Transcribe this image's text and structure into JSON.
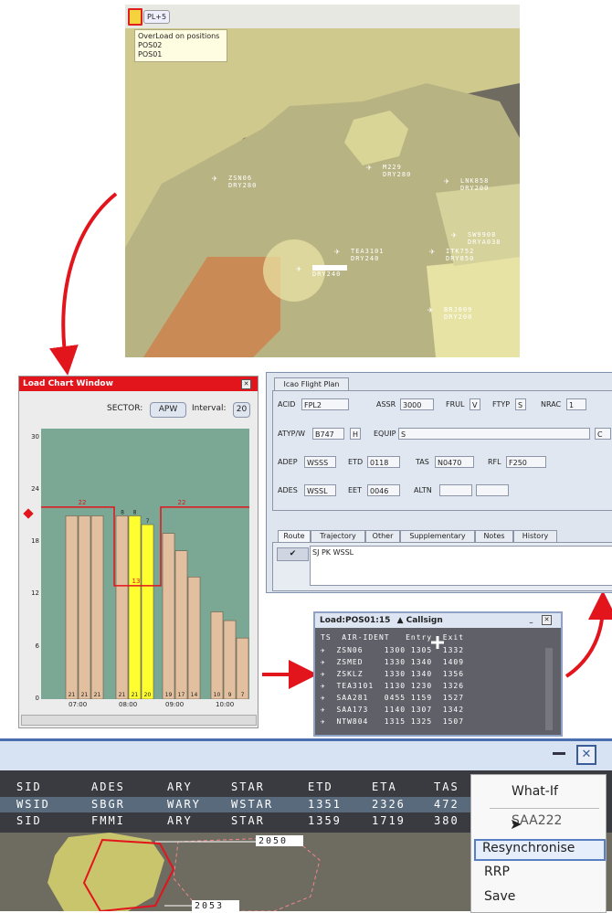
{
  "radar": {
    "toolbar": {
      "pl_button": "PL+5"
    },
    "tooltip": {
      "title": "OverLoad on positions",
      "items": [
        "POS02",
        "POS01"
      ]
    },
    "aircraft": [
      {
        "callsign": "ZSN06",
        "level": "DRY280"
      },
      {
        "callsign": "M229",
        "level": "DRY280"
      },
      {
        "callsign": "LNK858",
        "level": "DRY200"
      },
      {
        "callsign": "SW9908",
        "level": "DRYA038"
      },
      {
        "callsign": "TEA3101",
        "level": "DRY240"
      },
      {
        "callsign": "ITK752",
        "level": "DRY850"
      },
      {
        "callsign": "",
        "level": "DRY240"
      },
      {
        "callsign": "BRJ009",
        "level": "DRY200"
      }
    ]
  },
  "load_chart": {
    "title": "Load Chart Window",
    "sector_label": "SECTOR:",
    "sector_value": "APW",
    "interval_label": "Interval:",
    "interval_value": "20",
    "close_icon": "close-icon",
    "colors": {
      "title": "#e2141c",
      "plot_bg": "#7aa894",
      "bar": "#e2bf9e",
      "bar_overload": "#ffff30",
      "capacity": "#e2141c"
    }
  },
  "chart_data": {
    "type": "bar",
    "y_ticks": [
      "30",
      "24",
      "18",
      "12",
      "6",
      "0"
    ],
    "ylim": [
      0,
      31
    ],
    "x_ticks": [
      "07:00",
      "08:00",
      "09:00",
      "10:00"
    ],
    "bars": [
      {
        "value": 21,
        "label": "21",
        "overload": false
      },
      {
        "value": 21,
        "label": "21",
        "overload": false
      },
      {
        "value": 21,
        "label": "21",
        "overload": false
      },
      {
        "value": 21,
        "label": "21",
        "overload": false
      },
      {
        "value": 21,
        "label": "21",
        "overload": true,
        "top_label": "8"
      },
      {
        "value": 20,
        "label": "20",
        "overload": true,
        "top_label": "7"
      },
      {
        "value": 19,
        "label": "19",
        "overload": false
      },
      {
        "value": 17,
        "label": "17",
        "overload": false
      },
      {
        "value": 14,
        "label": "14",
        "overload": false
      },
      {
        "value": 10,
        "label": "10",
        "overload": false
      },
      {
        "value": 9,
        "label": "9",
        "overload": false
      },
      {
        "value": 7,
        "label": "7",
        "overload": false
      }
    ],
    "capacity_labels": [
      "22",
      "22",
      "13"
    ],
    "extra_labels": [
      "8"
    ]
  },
  "icao": {
    "tab": "Icao Flight Plan",
    "fields": {
      "acid_label": "ACID",
      "acid": "FPL2",
      "assr_label": "ASSR",
      "assr": "3000",
      "frul_label": "FRUL",
      "frul": "V",
      "ftyp_label": "FTYP",
      "ftyp": "S",
      "nrac_label": "NRAC",
      "nrac": "1",
      "atyp_label": "ATYP/W",
      "atyp": "B747",
      "wake": "H",
      "equip_label": "EQUIP",
      "equip": "S",
      "equip2": "C",
      "adep_label": "ADEP",
      "adep": "WSSS",
      "etd_label": "ETD",
      "etd": "0118",
      "tas_label": "TAS",
      "tas": "N0470",
      "rfl_label": "RFL",
      "rfl": "F250",
      "ades_label": "ADES",
      "ades": "WSSL",
      "eet_label": "EET",
      "eet": "0046",
      "altn_label": "ALTN"
    },
    "subtabs": [
      "Route",
      "Trajectory",
      "Other",
      "Supplementary",
      "Notes",
      "History"
    ],
    "route": "SJ PK WSSL"
  },
  "load_pos": {
    "title": "Load:POS01:15",
    "sort": "▲ Callsign",
    "headers": "TS  AIR-IDENT   Entry  Exit",
    "rows": [
      {
        "ident": "ZSN06",
        "entry": "1300",
        "entry2": "1305",
        "exit": "1332"
      },
      {
        "ident": "ZSMED",
        "entry": "1330",
        "entry2": "1340",
        "exit": "1409"
      },
      {
        "ident": "ZSKLZ",
        "entry": "1330",
        "entry2": "1340",
        "exit": "1356"
      },
      {
        "ident": "TEA3101",
        "entry": "1130",
        "entry2": "1230",
        "exit": "1326"
      },
      {
        "ident": "SAA281",
        "entry": "0455",
        "entry2": "1159",
        "exit": "1527"
      },
      {
        "ident": "SAA173",
        "entry": "1140",
        "entry2": "1307",
        "exit": "1342"
      },
      {
        "ident": "NTW804",
        "entry": "1315",
        "entry2": "1325",
        "exit": "1507"
      }
    ]
  },
  "flight_list": {
    "headers": [
      "SID",
      "ADES",
      "ARY",
      "STAR",
      "ETD",
      "ETA",
      "TAS"
    ],
    "rows": [
      [
        "WSID",
        "SBGR",
        "WARY",
        "WSTAR",
        "1351",
        "2326",
        "472"
      ],
      [
        "SID",
        "FMMI",
        "ARY",
        "STAR",
        "1359",
        "1719",
        "380"
      ]
    ],
    "map_labels": [
      "2050",
      "2053"
    ]
  },
  "context_menu": {
    "items": [
      "What-If",
      "SAA222",
      "Resynchronise",
      "RRP",
      "Save"
    ],
    "highlight": "Resynchronise"
  }
}
